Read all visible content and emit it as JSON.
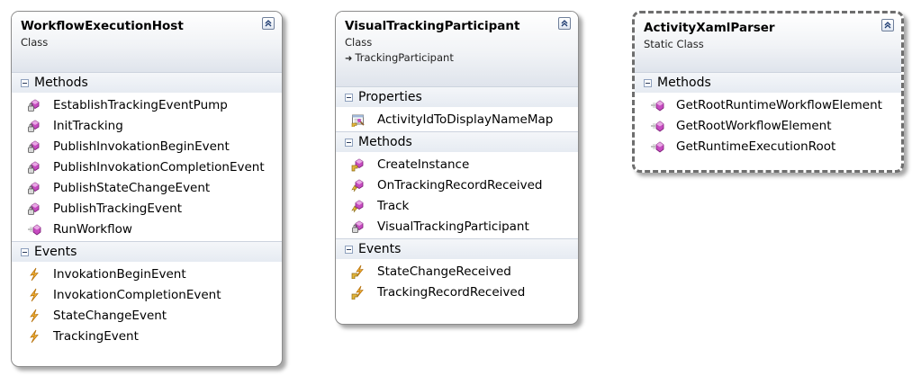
{
  "classes": [
    {
      "name": "WorkflowExecutionHost",
      "kind": "Class",
      "compartments": [
        {
          "label": "Methods",
          "items": [
            {
              "label": "EstablishTrackingEventPump",
              "icon": "private-method-icon"
            },
            {
              "label": "InitTracking",
              "icon": "private-method-icon"
            },
            {
              "label": "PublishInvokationBeginEvent",
              "icon": "private-method-icon"
            },
            {
              "label": "PublishInvokationCompletionEvent",
              "icon": "private-method-icon"
            },
            {
              "label": "PublishStateChangeEvent",
              "icon": "private-method-icon"
            },
            {
              "label": "PublishTrackingEvent",
              "icon": "private-method-icon"
            },
            {
              "label": "RunWorkflow",
              "icon": "public-method-icon"
            }
          ]
        },
        {
          "label": "Events",
          "items": [
            {
              "label": "InvokationBeginEvent",
              "icon": "event-icon"
            },
            {
              "label": "InvokationCompletionEvent",
              "icon": "event-icon"
            },
            {
              "label": "StateChangeEvent",
              "icon": "event-icon"
            },
            {
              "label": "TrackingEvent",
              "icon": "event-icon"
            }
          ]
        }
      ]
    },
    {
      "name": "VisualTrackingParticipant",
      "kind": "Class",
      "base": "TrackingParticipant",
      "compartments": [
        {
          "label": "Properties",
          "items": [
            {
              "label": "ActivityIdToDisplayNameMap",
              "icon": "property-icon"
            }
          ]
        },
        {
          "label": "Methods",
          "items": [
            {
              "label": "CreateInstance",
              "icon": "protected-method-icon"
            },
            {
              "label": "OnTrackingRecordReceived",
              "icon": "protected-override-method-icon"
            },
            {
              "label": "Track",
              "icon": "protected-override-method-icon"
            },
            {
              "label": "VisualTrackingParticipant",
              "icon": "private-method-icon"
            }
          ]
        },
        {
          "label": "Events",
          "items": [
            {
              "label": "StateChangeReceived",
              "icon": "protected-event-icon"
            },
            {
              "label": "TrackingRecordReceived",
              "icon": "protected-event-icon"
            }
          ]
        }
      ]
    },
    {
      "name": "ActivityXamlParser",
      "kind": "Static Class",
      "compartments": [
        {
          "label": "Methods",
          "items": [
            {
              "label": "GetRootRuntimeWorkflowElement",
              "icon": "public-method-icon"
            },
            {
              "label": "GetRootWorkflowElement",
              "icon": "public-method-icon"
            },
            {
              "label": "GetRuntimeExecutionRoot",
              "icon": "public-method-icon"
            }
          ]
        }
      ]
    }
  ]
}
